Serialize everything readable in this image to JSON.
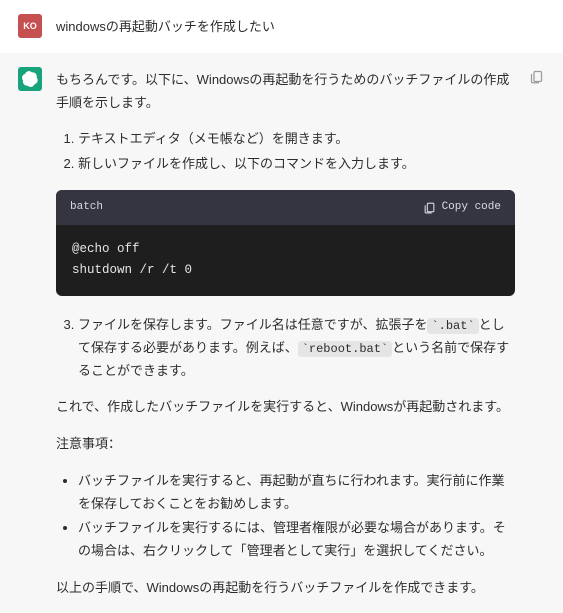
{
  "user": {
    "avatar": "KO",
    "text": "windowsの再起動バッチを作成したい"
  },
  "assistant": {
    "intro": "もちろんです。以下に、Windowsの再起動を行うためのバッチファイルの作成手順を示します。",
    "steps12": [
      "テキストエディタ（メモ帳など）を開きます。",
      "新しいファイルを作成し、以下のコマンドを入力します。"
    ],
    "code": {
      "lang": "batch",
      "copy_label": "Copy code",
      "body": "@echo off\nshutdown /r /t 0"
    },
    "step3_prefix": "ファイルを保存します。ファイル名は任意ですが、拡張子を",
    "step3_code1": ".bat",
    "step3_mid": "として保存する必要があります。例えば、",
    "step3_code2": "reboot.bat",
    "step3_suffix": "という名前で保存することができます。",
    "after_steps": "これで、作成したバッチファイルを実行すると、Windowsが再起動されます。",
    "notes_heading": "注意事項：",
    "notes": [
      "バッチファイルを実行すると、再起動が直ちに行われます。実行前に作業を保存しておくことをお勧めします。",
      "バッチファイルを実行するには、管理者権限が必要な場合があります。その場合は、右クリックして「管理者として実行」を選択してください。"
    ],
    "closing": "以上の手順で、Windowsの再起動を行うバッチファイルを作成できます。"
  }
}
